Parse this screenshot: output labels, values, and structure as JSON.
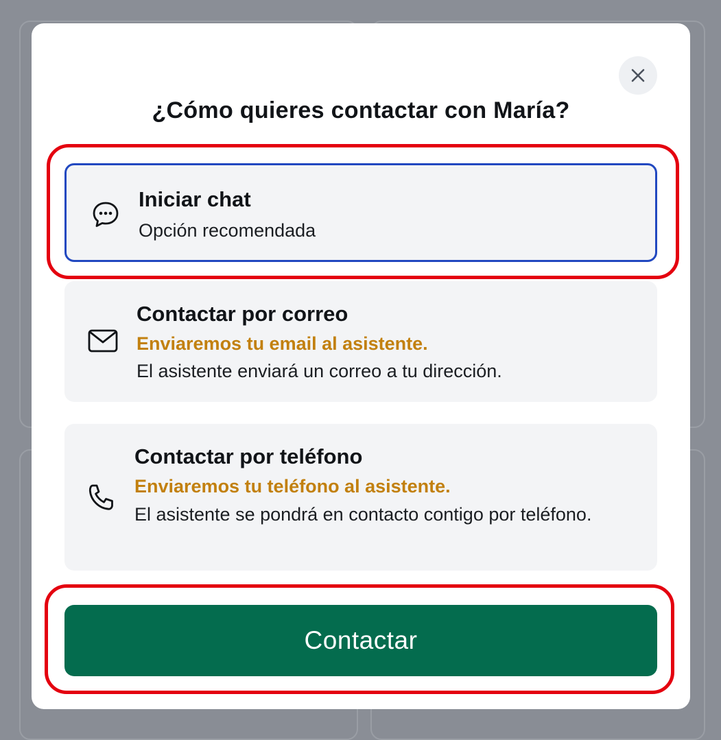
{
  "modal": {
    "title": "¿Cómo quieres contactar con María?",
    "close_icon": "close-icon"
  },
  "options": [
    {
      "icon": "chat-bubble-icon",
      "title": "Iniciar chat",
      "subtitle": "Opción recomendada",
      "selected": true
    },
    {
      "icon": "mail-icon",
      "title": "Contactar por correo",
      "warning": "Enviaremos tu email al asistente.",
      "description": "El asistente enviará un correo a tu dirección."
    },
    {
      "icon": "phone-icon",
      "title": "Contactar por teléfono",
      "warning": "Enviaremos tu teléfono al asistente.",
      "description": "El asistente se pondrá en contacto contigo por teléfono."
    }
  ],
  "cta": {
    "label": "Contactar"
  },
  "colors": {
    "primary": "#046c4e",
    "selected_border": "#2148c0",
    "warning_text": "#c2800f",
    "highlight": "#e4000f",
    "option_bg": "#f3f4f6"
  }
}
